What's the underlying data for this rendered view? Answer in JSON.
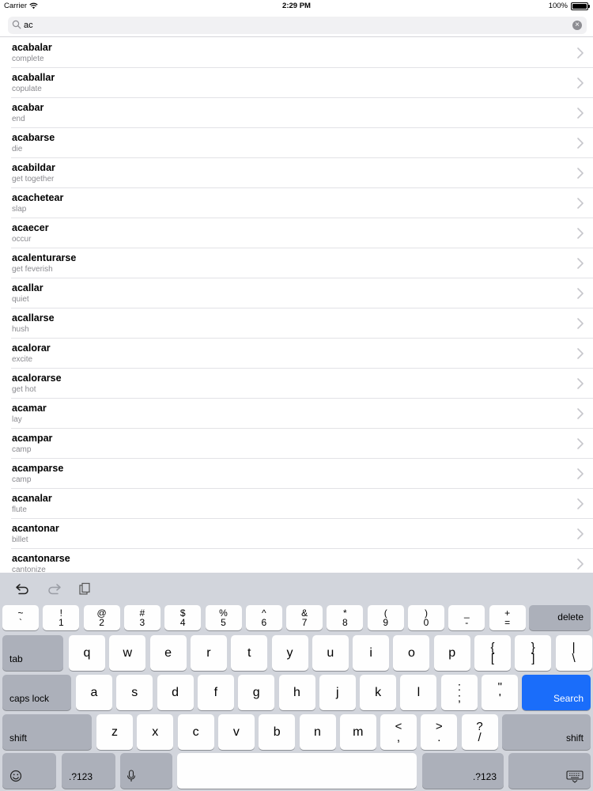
{
  "status_bar": {
    "carrier": "Carrier",
    "time": "2:29 PM",
    "battery": "100%",
    "battery_level": 1.0
  },
  "search": {
    "value": "ac",
    "placeholder": ""
  },
  "words": [
    {
      "term": "acabalar",
      "gloss": "complete"
    },
    {
      "term": "acaballar",
      "gloss": "copulate"
    },
    {
      "term": "acabar",
      "gloss": "end"
    },
    {
      "term": "acabarse",
      "gloss": "die"
    },
    {
      "term": "acabildar",
      "gloss": "get together"
    },
    {
      "term": "acachetear",
      "gloss": "slap"
    },
    {
      "term": "acaecer",
      "gloss": "occur"
    },
    {
      "term": "acalenturarse",
      "gloss": "get feverish"
    },
    {
      "term": "acallar",
      "gloss": "quiet"
    },
    {
      "term": "acallarse",
      "gloss": "hush"
    },
    {
      "term": "acalorar",
      "gloss": "excite"
    },
    {
      "term": "acalorarse",
      "gloss": "get hot"
    },
    {
      "term": "acamar",
      "gloss": "lay"
    },
    {
      "term": "acampar",
      "gloss": "camp"
    },
    {
      "term": "acamparse",
      "gloss": "camp"
    },
    {
      "term": "acanalar",
      "gloss": "flute"
    },
    {
      "term": "acantonar",
      "gloss": "billet"
    },
    {
      "term": "acantonarse",
      "gloss": "cantonize"
    }
  ],
  "keyboard": {
    "row1": [
      [
        "~",
        "`"
      ],
      [
        "!",
        "1"
      ],
      [
        "@",
        "2"
      ],
      [
        "#",
        "3"
      ],
      [
        "$",
        "4"
      ],
      [
        "%",
        "5"
      ],
      [
        "^",
        "6"
      ],
      [
        "&",
        "7"
      ],
      [
        "*",
        "8"
      ],
      [
        "(",
        "9"
      ],
      [
        ")",
        "0"
      ],
      [
        "_",
        "-"
      ],
      [
        "+",
        "="
      ]
    ],
    "delete": "delete",
    "tab": "tab",
    "row2": [
      "q",
      "w",
      "e",
      "r",
      "t",
      "y",
      "u",
      "i",
      "o",
      "p"
    ],
    "row2_punct": [
      [
        "{",
        "["
      ],
      [
        "}",
        "]"
      ],
      [
        "|",
        "\\"
      ]
    ],
    "caps_lock": "caps lock",
    "row3": [
      "a",
      "s",
      "d",
      "f",
      "g",
      "h",
      "j",
      "k",
      "l"
    ],
    "row3_punct": [
      [
        ":",
        ";"
      ],
      [
        "\"",
        "'"
      ]
    ],
    "search": "Search",
    "shift": "shift",
    "row4": [
      "z",
      "x",
      "c",
      "v",
      "b",
      "n",
      "m"
    ],
    "row4_punct": [
      [
        "<",
        ","
      ],
      [
        ">",
        "."
      ],
      [
        "?",
        "/"
      ]
    ],
    "numbers": ".?123"
  }
}
